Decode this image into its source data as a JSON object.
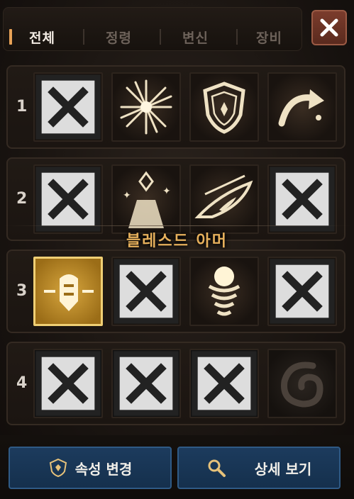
{
  "tabs": [
    {
      "label": "전체",
      "active": true
    },
    {
      "label": "정령",
      "active": false
    },
    {
      "label": "변신",
      "active": false
    },
    {
      "label": "장비",
      "active": false
    }
  ],
  "rows": [
    {
      "number": "1",
      "slots": [
        "lightning-icon",
        "starburst-icon",
        "shield-icon",
        "curved-arrow-icon"
      ]
    },
    {
      "number": "2",
      "slots": [
        "crossed-wing-icon",
        "summon-icon",
        "eye-icon",
        "thorn-gear-icon"
      ]
    },
    {
      "number": "3",
      "slots": [
        "blessed-armor-icon",
        "cycle-arrows-icon",
        "spring-orb-icon",
        "sparkle-flame-icon"
      ]
    },
    {
      "number": "4",
      "slots": [
        "comet-icon",
        "break-arrow-icon",
        "bat-wing-icon",
        "swirl-icon"
      ]
    }
  ],
  "tooltip": "블레스드 아머",
  "buttons": {
    "change_attribute": "속성 변경",
    "view_details": "상세 보기"
  },
  "colors": {
    "accent": "#e7a257",
    "selected": "#d7a63e",
    "teal": "#3fd3c2",
    "crimson": "#b03a4c",
    "button_blue": "#1c3b5d"
  }
}
